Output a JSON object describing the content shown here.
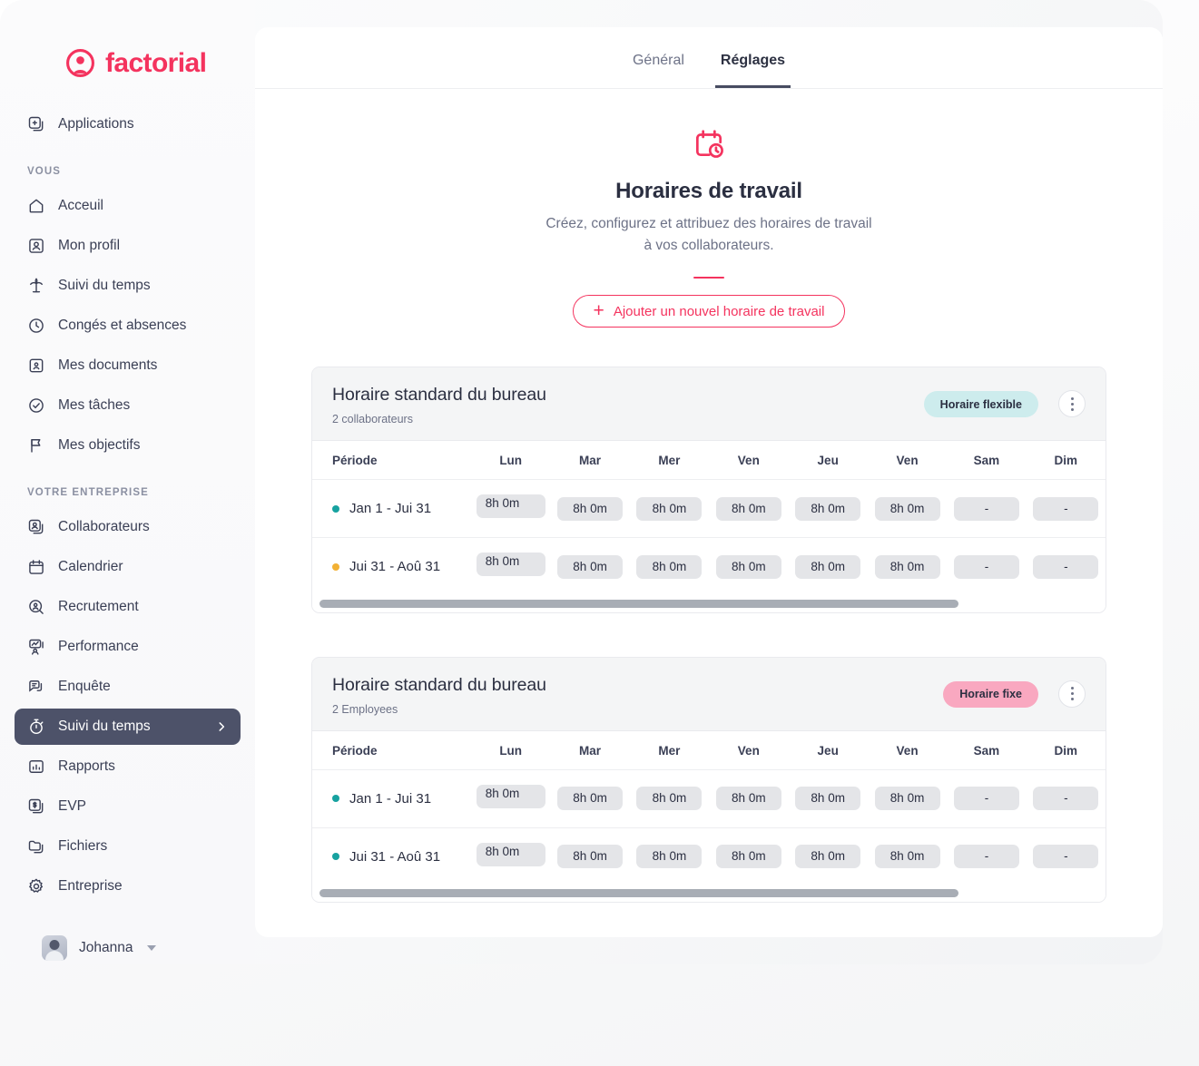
{
  "brand": {
    "name": "factorial",
    "color": "#f4335e",
    "logo_icon": "factorial-circle-logo"
  },
  "sidebar": {
    "top_item": {
      "label": "Applications",
      "icon": "apps-plus-icon"
    },
    "sections": [
      {
        "title": "VOUS",
        "items": [
          {
            "label": "Acceuil",
            "icon": "home-icon"
          },
          {
            "label": "Mon profil",
            "icon": "user-card-icon"
          },
          {
            "label": "Suivi du temps",
            "icon": "palm-tree-icon"
          },
          {
            "label": "Congés et absences",
            "icon": "clock-icon"
          },
          {
            "label": "Mes documents",
            "icon": "document-portrait-icon"
          },
          {
            "label": "Mes tâches",
            "icon": "check-circle-icon"
          },
          {
            "label": "Mes objectifs",
            "icon": "flag-icon"
          }
        ]
      },
      {
        "title": "VOTRE ENTREPRISE",
        "items": [
          {
            "label": "Collaborateurs",
            "icon": "users-stack-icon"
          },
          {
            "label": "Calendrier",
            "icon": "calendar-icon"
          },
          {
            "label": "Recrutement",
            "icon": "magnifier-user-icon"
          },
          {
            "label": "Performance",
            "icon": "performance-chart-icon"
          },
          {
            "label": "Enquête",
            "icon": "survey-chat-icon"
          },
          {
            "label": "Suivi du temps",
            "icon": "stopwatch-icon",
            "active": true,
            "chevron": "chevron-right-icon"
          },
          {
            "label": "Rapports",
            "icon": "bar-chart-icon"
          },
          {
            "label": "EVP",
            "icon": "money-document-icon"
          },
          {
            "label": "Fichiers",
            "icon": "folder-icon"
          },
          {
            "label": "Entreprise",
            "icon": "gear-icon"
          }
        ]
      }
    ],
    "user": {
      "name": "Johanna",
      "avatar": "user-avatar",
      "caret": "caret-down-icon"
    }
  },
  "tabs": [
    {
      "label": "Général",
      "active": false
    },
    {
      "label": "Réglages",
      "active": true
    }
  ],
  "hero": {
    "icon": "calendar-clock-icon",
    "title": "Horaires de travail",
    "subtitle": "Créez, configurez et attribuez des horaires de travail à vos collaborateurs.",
    "add_button": {
      "label": "Ajouter un nouvel horaire de travail",
      "icon": "plus-icon"
    }
  },
  "columns": [
    "Période",
    "Lun",
    "Mar",
    "Mer",
    "Ven",
    "Jeu",
    "Ven",
    "Sam",
    "Dim"
  ],
  "cards": [
    {
      "title": "Horaire standard du bureau",
      "subtitle": "2 collaborateurs",
      "badge": {
        "label": "Horaire flexible",
        "bg": "#cdeced",
        "fg": "#2b2f41"
      },
      "menu_icon": "kebab-menu-icon",
      "rows": [
        {
          "period": "Jan 1 - Jui 31",
          "dot_color": "#17a2a0",
          "values": [
            "8h 0m",
            "8h 0m",
            "8h 0m",
            "8h 0m",
            "8h 0m",
            "8h 0m",
            "-",
            "-"
          ]
        },
        {
          "period": "Jui 31 - Aoû 31",
          "dot_color": "#f2b134",
          "values": [
            "8h 0m",
            "8h 0m",
            "8h 0m",
            "8h 0m",
            "8h 0m",
            "8h 0m",
            "-",
            "-"
          ]
        }
      ],
      "scroll_percent": 82
    },
    {
      "title": "Horaire standard du bureau",
      "subtitle": "2 Employees",
      "badge": {
        "label": "Horaire fixe",
        "bg": "#f9a8c0",
        "fg": "#2b2f41"
      },
      "menu_icon": "kebab-menu-icon",
      "rows": [
        {
          "period": "Jan 1 - Jui 31",
          "dot_color": "#17a2a0",
          "values": [
            "8h 0m",
            "8h 0m",
            "8h 0m",
            "8h 0m",
            "8h 0m",
            "8h 0m",
            "-",
            "-"
          ]
        },
        {
          "period": "Jui 31 - Aoû 31",
          "dot_color": "#17a2a0",
          "values": [
            "8h 0m",
            "8h 0m",
            "8h 0m",
            "8h 0m",
            "8h 0m",
            "8h 0m",
            "-",
            "-"
          ]
        }
      ],
      "scroll_percent": 82
    }
  ]
}
